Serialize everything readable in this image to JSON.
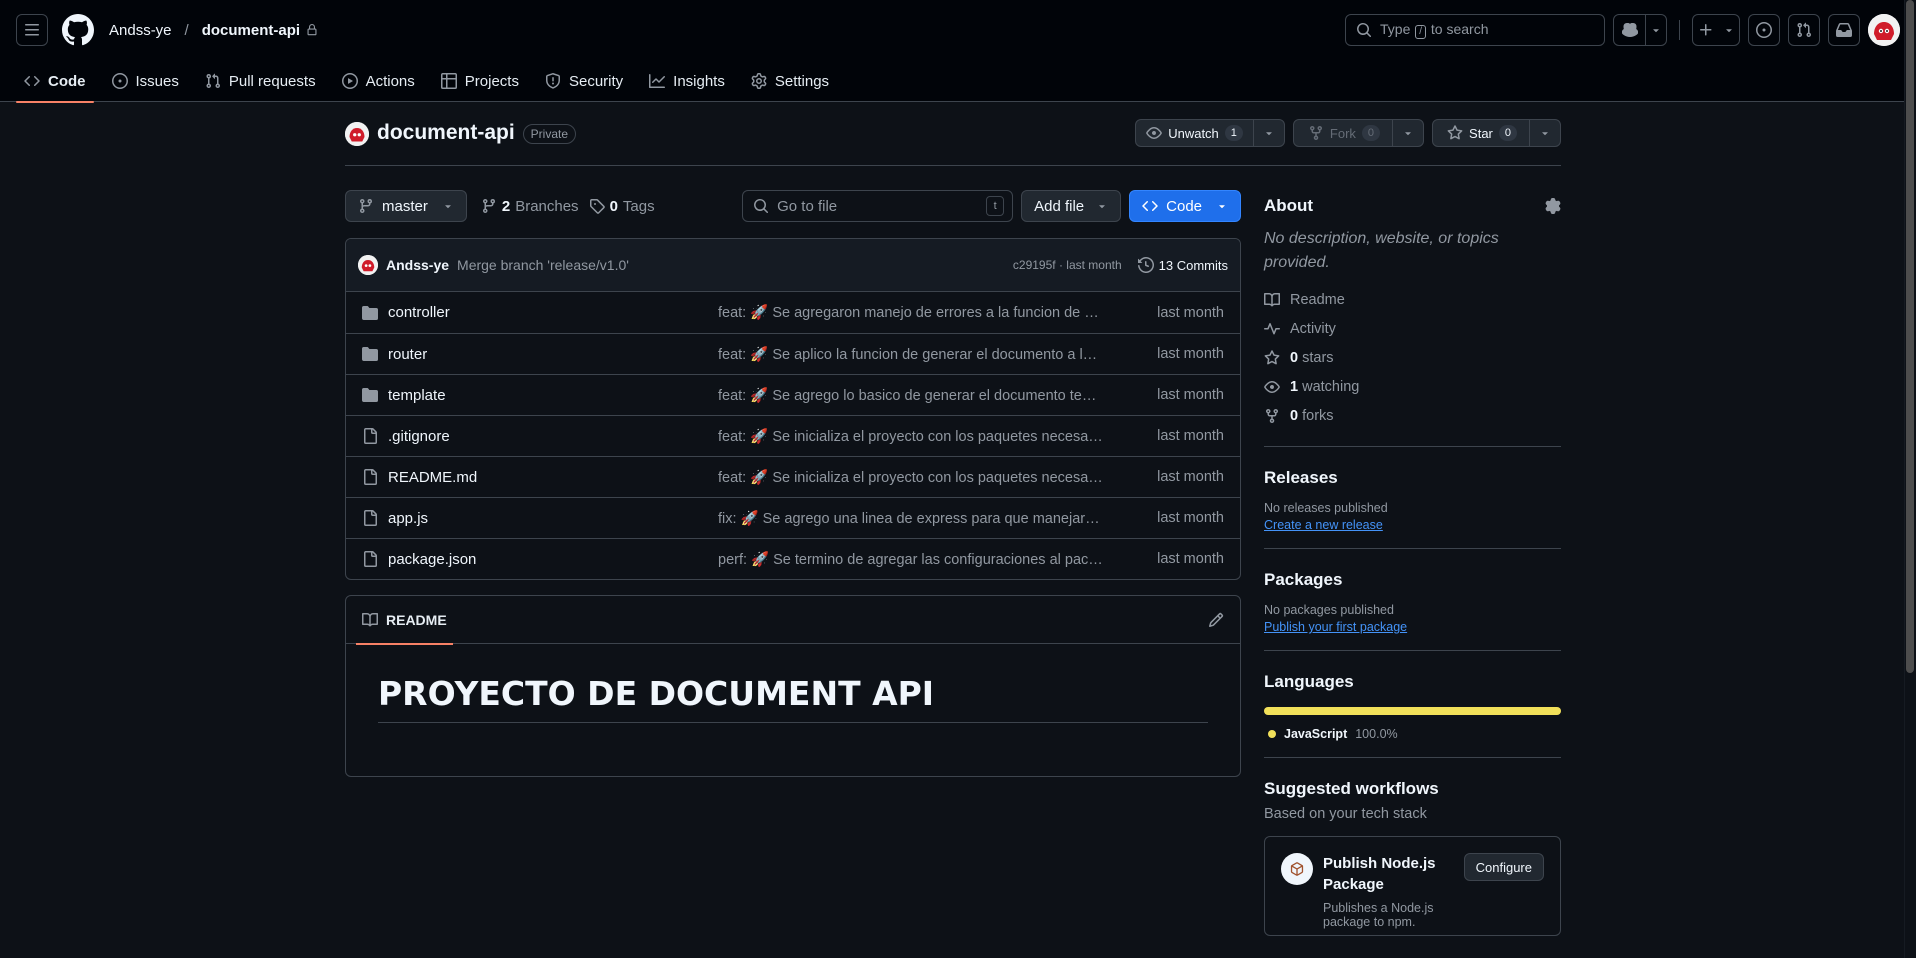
{
  "header": {
    "owner": "Andss-ye",
    "separator": "/",
    "repo": "document-api",
    "search_prefix": "Type",
    "search_key": "/",
    "search_suffix": "to search"
  },
  "nav": {
    "code": "Code",
    "issues": "Issues",
    "pulls": "Pull requests",
    "actions": "Actions",
    "projects": "Projects",
    "security": "Security",
    "insights": "Insights",
    "settings": "Settings"
  },
  "repo": {
    "name": "document-api",
    "visibility": "Private",
    "unwatch_label": "Unwatch",
    "watch_count": "1",
    "fork_label": "Fork",
    "fork_count": "0",
    "star_label": "Star",
    "star_count": "0"
  },
  "toolbar": {
    "branch": "master",
    "branches_count": "2",
    "branches_label": "Branches",
    "tags_count": "0",
    "tags_label": "Tags",
    "goto_placeholder": "Go to file",
    "goto_key": "t",
    "add_file": "Add file",
    "code_btn": "Code"
  },
  "latest_commit": {
    "author": "Andss-ye",
    "message": "Merge branch 'release/v1.0'",
    "meta": "c29195f · last month",
    "commits": "13 Commits"
  },
  "files": [
    {
      "type": "dir",
      "name": "controller",
      "message": "feat: 🚀 Se agregaron manejo de errores a la funcion de generar el documento",
      "time": "last month"
    },
    {
      "type": "dir",
      "name": "router",
      "message": "feat: 🚀 Se aplico la funcion de generar el documento a la ruta",
      "time": "last month"
    },
    {
      "type": "dir",
      "name": "template",
      "message": "feat: 🚀 Se agrego lo basico de generar el documento template",
      "time": "last month"
    },
    {
      "type": "file",
      "name": ".gitignore",
      "message": "feat: 🚀 Se inicializa el proyecto con los paquetes necesarios",
      "time": "last month"
    },
    {
      "type": "file",
      "name": "README.md",
      "message": "feat: 🚀 Se inicializa el proyecto con los paquetes necesarios",
      "time": "last month"
    },
    {
      "type": "file",
      "name": "app.js",
      "message": "fix: 🚀 Se agrego una linea de express para que manejara json",
      "time": "last month"
    },
    {
      "type": "file",
      "name": "package.json",
      "message": "perf: 🚀 Se termino de agregar las configuraciones al package",
      "time": "last month"
    }
  ],
  "readme": {
    "tab": "README",
    "heading": "PROYECTO DE DOCUMENT API"
  },
  "sidebar": {
    "about_title": "About",
    "about_desc": "No description, website, or topics provided.",
    "readme": "Readme",
    "activity": "Activity",
    "stars_count": "0",
    "stars_label": "stars",
    "watching_count": "1",
    "watching_label": "watching",
    "forks_count": "0",
    "forks_label": "forks",
    "releases_title": "Releases",
    "releases_none": "No releases published",
    "releases_link": "Create a new release",
    "packages_title": "Packages",
    "packages_none": "No packages published",
    "packages_link": "Publish your first package",
    "languages_title": "Languages",
    "lang_name": "JavaScript",
    "lang_pct": "100.0%",
    "lang_color": "#f1e05a",
    "workflows_title": "Suggested workflows",
    "workflows_sub": "Based on your tech stack",
    "wf_title": "Publish Node.js Package",
    "wf_desc": "Publishes a Node.js package to npm.",
    "wf_btn": "Configure"
  },
  "colors": {
    "accent_blue": "#1f6feb",
    "nav_underline": "#f78166",
    "link": "#4493f8"
  }
}
